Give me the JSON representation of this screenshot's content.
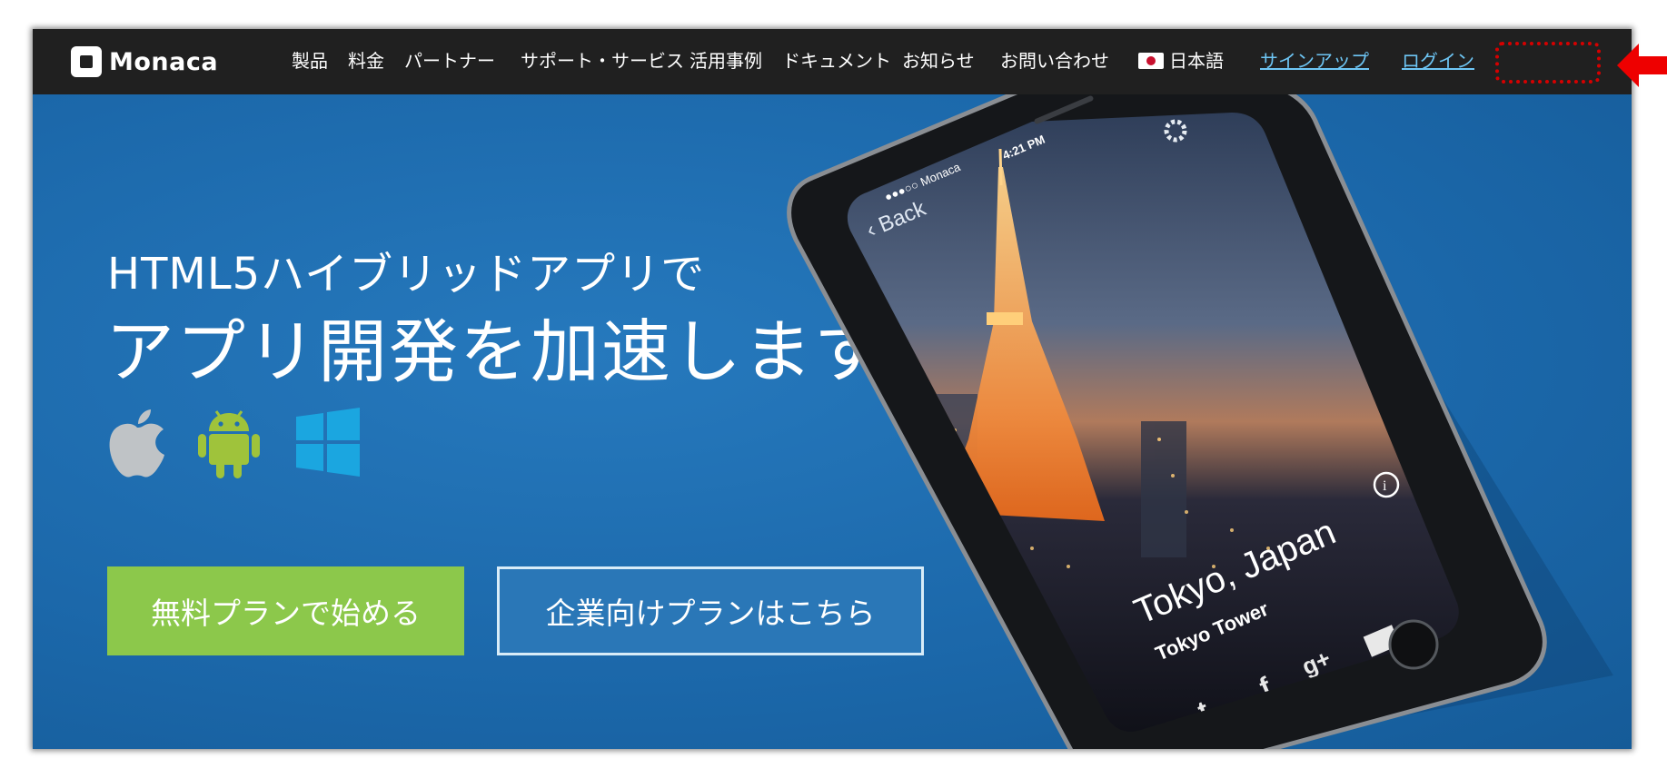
{
  "brand": {
    "name": "Monaca",
    "logo_icon": "monaca-logo-icon"
  },
  "nav": {
    "items": [
      {
        "label": "製品"
      },
      {
        "label": "料金"
      },
      {
        "label": "パートナー"
      },
      {
        "label": "サポート・サービス"
      },
      {
        "label": "活用事例"
      },
      {
        "label": "ドキュメント"
      },
      {
        "label": "お知らせ"
      },
      {
        "label": "お問い合わせ"
      }
    ],
    "language": {
      "label": "日本語",
      "icon": "japan-flag-icon"
    },
    "signup": "サインアップ",
    "login": "ログイン"
  },
  "hero": {
    "subtitle": "HTML5ハイブリッドアプリで",
    "headline": "アプリ開発を加速します",
    "platform_icons": [
      "apple-icon",
      "android-icon",
      "windows-icon"
    ],
    "primary_button": "無料プランで始める",
    "secondary_button": "企業向けプランはこちら"
  },
  "phone_screen": {
    "status_left": "●●●○○ Monaca",
    "status_time": "4:21 PM",
    "back_label": "Back",
    "city": "Tokyo, Japan",
    "place": "Tokyo Tower",
    "social_icons": [
      "twitter-icon",
      "facebook-icon",
      "google-plus-icon",
      "mail-icon"
    ]
  },
  "colors": {
    "nav_bg": "#202020",
    "hero_bg": "#1f6fb0",
    "primary_button": "#8cc84b",
    "link": "#6ec6f5",
    "highlight": "#d60000"
  }
}
